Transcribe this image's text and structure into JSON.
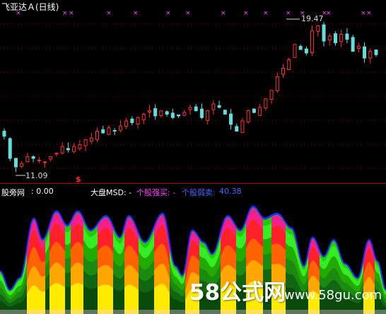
{
  "stock_title": "飞亚达Ａ(日线)",
  "price_high_label": "19.47",
  "price_low_label": "11.09",
  "signal_mark": "$",
  "indicator": {
    "name": "股旁网",
    "value": ": 0.00",
    "msd_label": "大盘MSD: -",
    "strong_buy": "个股强买: -",
    "strong_sell": "个股弱卖:",
    "sell_value": "40.38"
  },
  "colors": {
    "bg": "#000000",
    "dotted_grid": "#8b0000",
    "up_candle": "#ff3333",
    "down_candle": "#66dddd",
    "marker": "#ff44ff",
    "price_label": "#d8d8d8"
  },
  "watermark": {
    "logo": "58公式网",
    "url": "www.58gu.com"
  },
  "chart_data": {
    "type": "candlestick",
    "series": [
      {
        "values": [
          12.9,
          11.6,
          11.1,
          11.3,
          11.7,
          11.6,
          11.5,
          11.4,
          11.7,
          11.9,
          12.3,
          12.1,
          12.3,
          12.4,
          12.7,
          12.8,
          13.2,
          13.1,
          13.4,
          13.2,
          13.5,
          13.8,
          13.7,
          14.0,
          14.2,
          14.4,
          14.1,
          14.4,
          14.2,
          14.0,
          14.1,
          14.3,
          14.6,
          14.4,
          14.0,
          14.4,
          14.8,
          14.6,
          14.2,
          13.6,
          13.2,
          13.8,
          14.4,
          14.3,
          14.6,
          15.1,
          15.6,
          16.4,
          16.9,
          17.4,
          18.3,
          18.0,
          17.8,
          19.1,
          19.4,
          18.5,
          18.8,
          18.4,
          18.9,
          18.6,
          17.9,
          18.2,
          17.5,
          17.9,
          17.7
        ],
        "type": "close"
      }
    ],
    "markers": 13,
    "price_high": 19.47,
    "price_low": 11.09
  }
}
